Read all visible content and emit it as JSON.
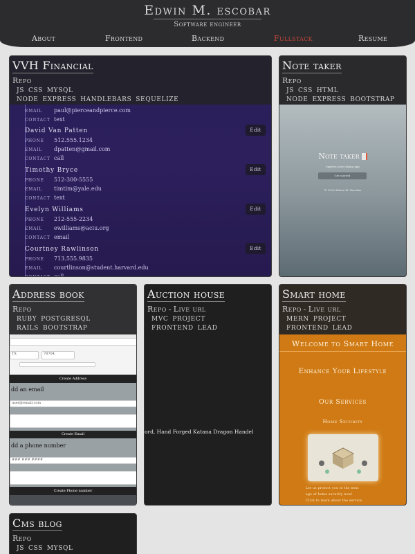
{
  "header": {
    "name": "Edwin M. escobar",
    "subtitle": "Software engineer",
    "nav": [
      "About",
      "Frontend",
      "Backend",
      "Fullstack",
      "Resume"
    ],
    "active": "Fullstack",
    "accent_color": "#c44536"
  },
  "projects": [
    {
      "title": "VVH Financial",
      "links": [
        "Repo"
      ],
      "tags_row1": [
        "JS",
        "CSS",
        "MYSQL"
      ],
      "tags_row2": [
        "NODE",
        "EXPRESS",
        "HANDLEBARS",
        "SEQUELIZE"
      ],
      "preview": {
        "top_partial": {
          "email": "paul@pierceandpierce.com",
          "contact": "text"
        },
        "contacts": [
          {
            "name": "David Van Patten",
            "phone": "512.555.1234",
            "email": "dpatten@gmail.com",
            "contact": "call"
          },
          {
            "name": "Timothy Bryce",
            "phone": "512-300-5555",
            "email": "timtim@yale.edu",
            "contact": "text"
          },
          {
            "name": "Evelyn Williams",
            "phone": "212-555-2234",
            "email": "ewilliams@aciu.org",
            "contact": "email"
          },
          {
            "name": "Courtney Rawlinson",
            "phone": "713.555.9835",
            "email": "courtlinson@student.harvard.edu",
            "contact": "call"
          }
        ],
        "labels": {
          "phone": "phone",
          "email": "email",
          "contact": "contact"
        },
        "edit_label": "Edit"
      }
    },
    {
      "title": "Note taker",
      "links": [
        "Repo"
      ],
      "tags_row1": [
        "JS",
        "CSS",
        "HTML"
      ],
      "tags_row2": [
        "NODE",
        "EXPRESS",
        "BOOTSTRAP"
      ],
      "preview": {
        "title": "Note taker",
        "subtitle": "express note taking app",
        "button": "Get started",
        "footer": "© 2022 Edwin M. Escobar"
      }
    },
    {
      "title": "Address book",
      "links": [
        "Repo"
      ],
      "tags_row1": [
        "RUBY",
        "POSTGRESQL"
      ],
      "tags_row2": [
        "RAILS",
        "BOOTSTRAP"
      ],
      "preview": {
        "zip_value": "78704",
        "state_value": "TX",
        "create_address": "Create Address",
        "add_email": "dd an email",
        "email_placeholder": "user@email.com",
        "create_email": "Create Email",
        "add_phone": "dd a phone number",
        "phone_placeholder": "### ### ####",
        "create_phone": "Create Phone number"
      }
    },
    {
      "title": "Auction house",
      "links": [
        "Repo",
        "Live url"
      ],
      "tags_row1": [
        "MVC",
        "PROJECT"
      ],
      "tags_row2": [
        "FRONTEND",
        "LEAD"
      ],
      "preview": {
        "text": "ord, Hand Forged Katana Dragon Handel"
      }
    },
    {
      "title": "Smart home",
      "links": [
        "Repo",
        "Live url"
      ],
      "tags_row1": [
        "MERN",
        "PROJECT"
      ],
      "tags_row2": [
        "FRONTEND",
        "LEAD"
      ],
      "preview": {
        "welcome": "Welcome to Smart Home",
        "enhance": "Enhance Your Lifestyle",
        "services": "Our Services",
        "security": "Home Security",
        "small_1": "Let us protect you to the next",
        "small_2": "age of home security now!",
        "small_3": "Click to learn about the service"
      }
    },
    {
      "title": "Cms blog",
      "links": [
        "Repo"
      ],
      "tags_row1": [
        "JS",
        "CSS",
        "MYSQL"
      ],
      "tags_row2": []
    }
  ]
}
